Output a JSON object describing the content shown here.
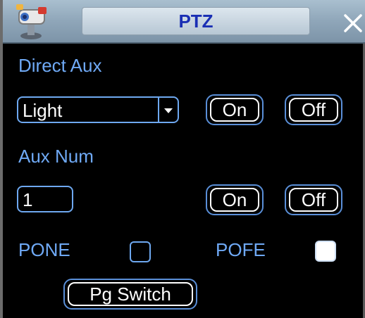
{
  "window": {
    "title": "PTZ"
  },
  "direct_aux": {
    "label": "Direct Aux",
    "selected": "Light",
    "on_label": "On",
    "off_label": "Off"
  },
  "aux_num": {
    "label": "Aux Num",
    "value": "1",
    "on_label": "On",
    "off_label": "Off"
  },
  "options": {
    "pone_label": "PONE",
    "pone_checked": false,
    "pofe_label": "POFE",
    "pofe_checked": true
  },
  "pg_switch_label": "Pg Switch",
  "icons": {
    "title": "camera-icon",
    "close": "close-icon"
  },
  "colors": {
    "label_text": "#6fa9f5",
    "title_text": "#1a2fb4",
    "border": "#6ea8f0"
  }
}
